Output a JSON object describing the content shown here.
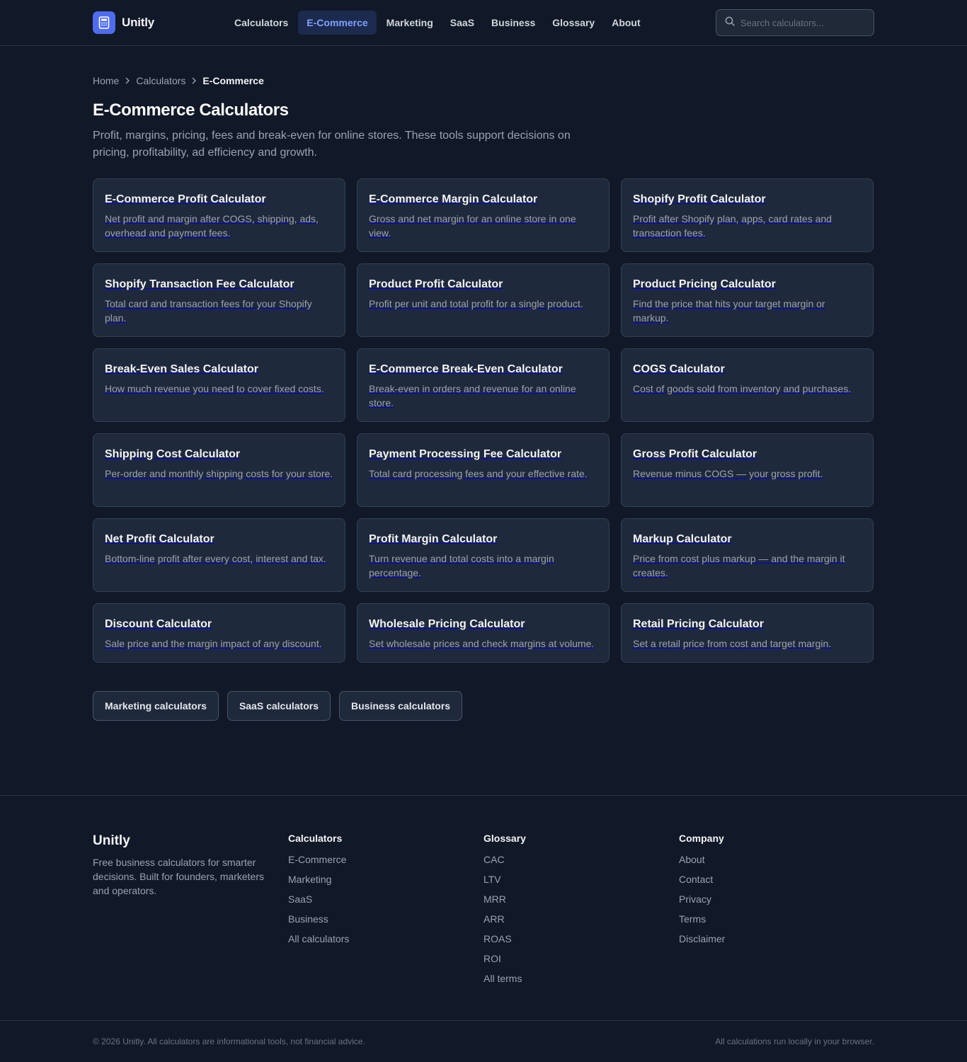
{
  "header": {
    "brand": "Unitly",
    "nav": [
      {
        "label": "Calculators",
        "active": false
      },
      {
        "label": "E-Commerce",
        "active": true
      },
      {
        "label": "Marketing",
        "active": false
      },
      {
        "label": "SaaS",
        "active": false
      },
      {
        "label": "Business",
        "active": false
      },
      {
        "label": "Glossary",
        "active": false
      },
      {
        "label": "About",
        "active": false
      }
    ],
    "search_placeholder": "Search calculators..."
  },
  "breadcrumb": {
    "items": [
      "Home",
      "Calculators"
    ],
    "current": "E-Commerce"
  },
  "page": {
    "title": "E-Commerce Calculators",
    "intro": "Profit, margins, pricing, fees and break-even for online stores. These tools support decisions on pricing, profitability, ad efficiency and growth."
  },
  "cards": [
    {
      "title": "E-Commerce Profit Calculator",
      "desc": "Net profit and margin after COGS, shipping, ads, overhead and payment fees."
    },
    {
      "title": "E-Commerce Margin Calculator",
      "desc": "Gross and net margin for an online store in one view."
    },
    {
      "title": "Shopify Profit Calculator",
      "desc": "Profit after Shopify plan, apps, card rates and transaction fees."
    },
    {
      "title": "Shopify Transaction Fee Calculator",
      "desc": "Total card and transaction fees for your Shopify plan."
    },
    {
      "title": "Product Profit Calculator",
      "desc": "Profit per unit and total profit for a single product."
    },
    {
      "title": "Product Pricing Calculator",
      "desc": "Find the price that hits your target margin or markup."
    },
    {
      "title": "Break-Even Sales Calculator",
      "desc": "How much revenue you need to cover fixed costs."
    },
    {
      "title": "E-Commerce Break-Even Calculator",
      "desc": "Break-even in orders and revenue for an online store."
    },
    {
      "title": "COGS Calculator",
      "desc": "Cost of goods sold from inventory and purchases."
    },
    {
      "title": "Shipping Cost Calculator",
      "desc": "Per-order and monthly shipping costs for your store."
    },
    {
      "title": "Payment Processing Fee Calculator",
      "desc": "Total card processing fees and your effective rate."
    },
    {
      "title": "Gross Profit Calculator",
      "desc": "Revenue minus COGS — your gross profit."
    },
    {
      "title": "Net Profit Calculator",
      "desc": "Bottom-line profit after every cost, interest and tax."
    },
    {
      "title": "Profit Margin Calculator",
      "desc": "Turn revenue and total costs into a margin percentage."
    },
    {
      "title": "Markup Calculator",
      "desc": "Price from cost plus markup — and the margin it creates."
    },
    {
      "title": "Discount Calculator",
      "desc": "Sale price and the margin impact of any discount."
    },
    {
      "title": "Wholesale Pricing Calculator",
      "desc": "Set wholesale prices and check margins at volume."
    },
    {
      "title": "Retail Pricing Calculator",
      "desc": "Set a retail price from cost and target margin."
    }
  ],
  "related": [
    "Marketing calculators",
    "SaaS calculators",
    "Business calculators"
  ],
  "footer": {
    "brand": "Unitly",
    "brand_desc": "Free business calculators for smarter decisions. Built for founders, marketers and operators.",
    "columns": [
      {
        "heading": "Calculators",
        "links": [
          "E-Commerce",
          "Marketing",
          "SaaS",
          "Business",
          "All calculators"
        ]
      },
      {
        "heading": "Glossary",
        "links": [
          "CAC",
          "LTV",
          "MRR",
          "ARR",
          "ROAS",
          "ROI",
          "All terms"
        ]
      },
      {
        "heading": "Company",
        "links": [
          "About",
          "Contact",
          "Privacy",
          "Terms",
          "Disclaimer"
        ]
      }
    ],
    "copyright": "© 2026 Unitly. All calculators are informational tools, not financial advice.",
    "note": "All calculations run locally in your browser."
  },
  "colors": {
    "background": "#111827",
    "card": "#1e293b",
    "accent": "#4f6bf0",
    "active_nav_text": "#7ea2ff"
  }
}
